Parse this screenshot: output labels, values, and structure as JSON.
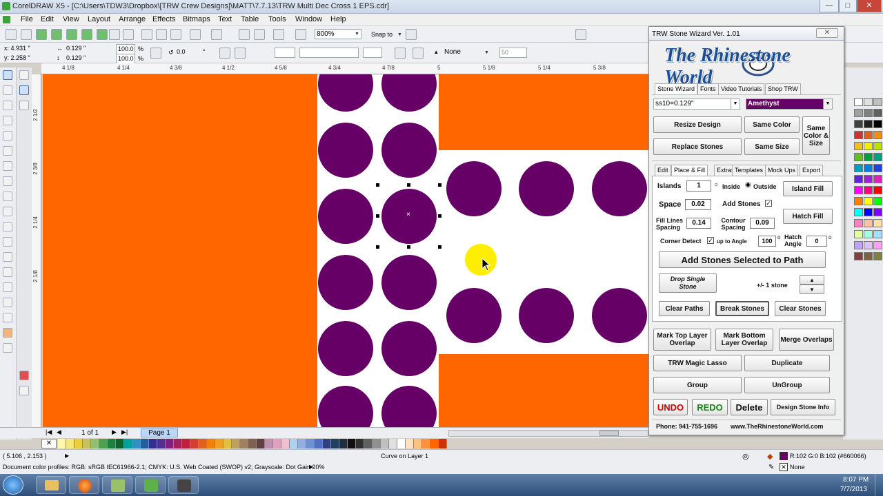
{
  "app": {
    "title": "CorelDRAW X5 - [C:\\Users\\TDW3\\Dropbox\\[TRW Crew Designs]\\MATT\\7.7.13\\TRW Multi Dec Cross 1 EPS.cdr]"
  },
  "menu": [
    "File",
    "Edit",
    "View",
    "Layout",
    "Arrange",
    "Effects",
    "Bitmaps",
    "Text",
    "Table",
    "Tools",
    "Window",
    "Help"
  ],
  "toolbar": {
    "zoom": "800%",
    "snap_to": "Snap to"
  },
  "propbar": {
    "x": "x: 4.931 \"",
    "y": "y: 2.258 \"",
    "w": "0.129 \"",
    "h": "0.129 \"",
    "scale_x": "100.0",
    "scale_y": "100.0",
    "pct": "%",
    "angle": "0.0",
    "deg": "°",
    "outline": "None",
    "outline_val": "50"
  },
  "ruler_h": [
    "4 1/8",
    "4 1/4",
    "4 3/8",
    "4 1/2",
    "4 5/8",
    "4 3/4",
    "4 7/8",
    "5",
    "5 1/8",
    "5 1/4",
    "5 3/8"
  ],
  "ruler_v": [
    "2 1/2",
    "2 3/8",
    "2 1/4",
    "2 1/8"
  ],
  "pages": {
    "count": "1 of 1",
    "current": "Page 1"
  },
  "status": {
    "coords": "( 5.106 , 2.153 )",
    "object": "Curve on Layer 1",
    "profiles": "Document color profiles: RGB: sRGB IEC61966-2.1; CMYK: U.S. Web Coated (SWOP) v2; Grayscale: Dot Gain 20%",
    "fill_info": "R:102 G:0 B:102 (#660066)",
    "outline_info": "None"
  },
  "clock": {
    "time": "8:07 PM",
    "date": "7/7/2013"
  },
  "wizard": {
    "title": "TRW Stone Wizard Ver. 1.01",
    "logo_text": "The Rhinestone World",
    "top_tabs": [
      "Stone Wizard",
      "Fonts",
      "Video Tutorials",
      "Shop TRW"
    ],
    "stone_size": "ss10=0.129\"",
    "stone_color": "Amethyst",
    "buttons": {
      "resize": "Resize Design",
      "same_color": "Same Color",
      "replace": "Replace Stones",
      "same_size": "Same Size",
      "same_color_size": "Same Color & Size",
      "island_fill": "Island Fill",
      "hatch_fill": "Hatch Fill",
      "add_to_path": "Add Stones Selected to Path",
      "drop_single": "Drop Single Stone",
      "clear_paths": "Clear Paths",
      "break_stones": "Break Stones",
      "clear_stones": "Clear Stones",
      "mark_top": "Mark Top Layer Overlap",
      "mark_bottom": "Mark Bottom Layer Overlap",
      "merge": "Merge Overlaps",
      "magic_lasso": "TRW Magic Lasso",
      "duplicate": "Duplicate",
      "group": "Group",
      "ungroup": "UnGroup",
      "undo": "UNDO",
      "redo": "REDO",
      "delete": "Delete",
      "design_info": "Design Stone Info"
    },
    "sub_tabs": [
      "Edit",
      "Place & Fill",
      "Extras",
      "Templates",
      "Mock Ups",
      "Export"
    ],
    "labels": {
      "islands": "Islands",
      "inside": "Inside",
      "outside": "Outside",
      "space": "Space",
      "add_stones": "Add Stones",
      "fill_lines": "Fill Lines Spacing",
      "contour": "Contour Spacing",
      "corner_detect": "Corner Detect",
      "up_to_angle": "up to Angle",
      "hatch_angle": "Hatch Angle",
      "plus_minus": "+/- 1 stone",
      "deg": "o"
    },
    "values": {
      "islands": "1",
      "space": "0.02",
      "fill_lines": "0.14",
      "contour": "0.09",
      "angle": "100",
      "hatch_angle": "0"
    },
    "footer_phone": "Phone: 941-755-1696",
    "footer_url": "www.TheRhinestoneWorld.com"
  },
  "colors": {
    "orange": "#ff6600",
    "amethyst": "#660066"
  }
}
